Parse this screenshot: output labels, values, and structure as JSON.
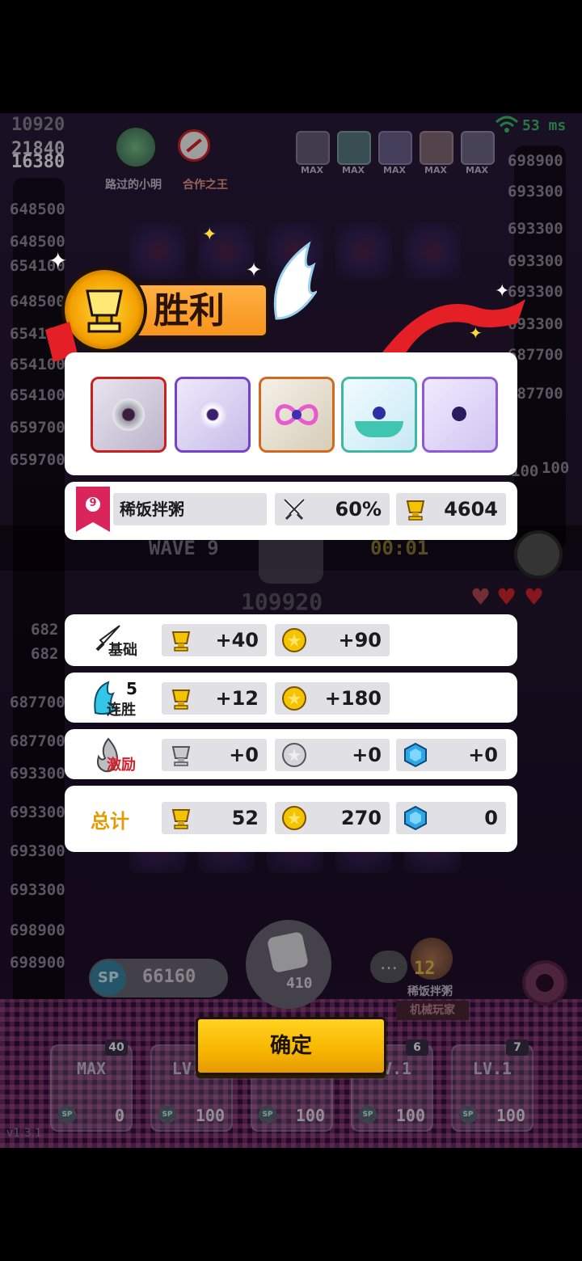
{
  "hud": {
    "score_top1": "10920",
    "score_top2": "21840",
    "score_top3": "16380",
    "ping": "53 ms",
    "player1_name": "路过的小明",
    "player1_tag": "合作之王",
    "max_labels": [
      "MAX",
      "MAX",
      "MAX",
      "MAX",
      "MAX"
    ],
    "left_numbers": [
      "648500",
      "648500",
      "654100",
      "648500",
      "654100",
      "654100",
      "654100",
      "659700",
      "659700",
      "682",
      "682",
      "687700",
      "687700",
      "693300",
      "693300",
      "693300",
      "693300",
      "698900",
      "698900"
    ],
    "right_numbers": [
      "698900",
      "693300",
      "693300",
      "693300",
      "693300",
      "693300",
      "687700",
      "687700",
      "100",
      "100"
    ],
    "wave": "WAVE 9",
    "timer": "00:01",
    "center_score": "109920",
    "sp_total": "66160",
    "dice_cost": "410",
    "partner_level": "12",
    "partner_name": "稀饭拌粥",
    "partner_tag": "机械玩家",
    "version": "v1.3.1",
    "hearts": 2
  },
  "cards": [
    {
      "level": "MAX",
      "cost": "0",
      "badge": "40"
    },
    {
      "level": "LV.1",
      "cost": "100",
      "badge": ""
    },
    {
      "level": "",
      "cost": "100",
      "badge": ""
    },
    {
      "level": "LV.1",
      "cost": "100",
      "badge": "6"
    },
    {
      "level": "LV.1",
      "cost": "100",
      "badge": "7"
    }
  ],
  "result": {
    "title": "胜利",
    "player_rank": "9",
    "player_name": "稀饭拌粥",
    "win_rate": "60%",
    "trophies": "4604"
  },
  "rewards": {
    "base_label": "基础",
    "base_trophy": "+40",
    "base_gold": "+90",
    "streak_count": "5",
    "streak_label": "连胜",
    "streak_trophy": "+12",
    "streak_gold": "+180",
    "bonus_label": "激励",
    "bonus_trophy": "+0",
    "bonus_silver": "+0",
    "bonus_gem": "+0",
    "total_label": "总计",
    "total_trophy": "52",
    "total_gold": "270",
    "total_gem": "0"
  },
  "confirm_label": "确定",
  "colors": {
    "gold": "#f5c400",
    "victory_orange": "#f7941d",
    "gem_blue": "#2fa7e6"
  }
}
